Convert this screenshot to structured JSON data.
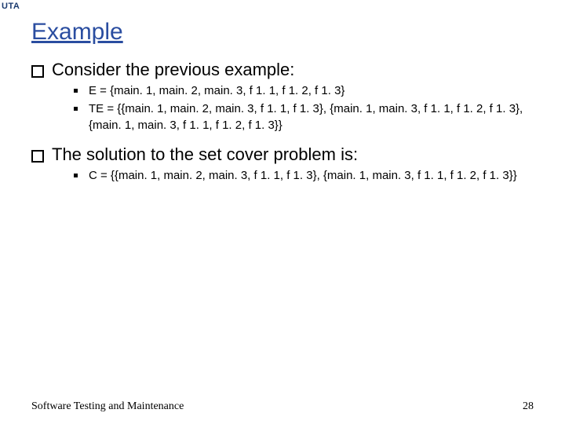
{
  "logo": "UTA",
  "title": "Example",
  "points": [
    {
      "text": "Consider the previous example:",
      "subs": [
        "E = {main. 1, main. 2, main. 3, f 1. 1, f 1. 2, f 1. 3}",
        "TE = {{main. 1, main. 2, main. 3, f 1. 1, f 1. 3}, {main. 1, main. 3, f 1. 1, f 1. 2, f 1. 3}, {main. 1, main. 3, f 1. 1, f 1. 2, f 1. 3}}"
      ]
    },
    {
      "text": "The solution to the set cover problem is:",
      "subs": [
        "C = {{main. 1, main. 2, main. 3, f 1. 1, f 1. 3}, {main. 1, main. 3, f 1. 1, f 1. 2, f 1. 3}}"
      ]
    }
  ],
  "footer_left": "Software Testing and Maintenance",
  "footer_right": "28"
}
